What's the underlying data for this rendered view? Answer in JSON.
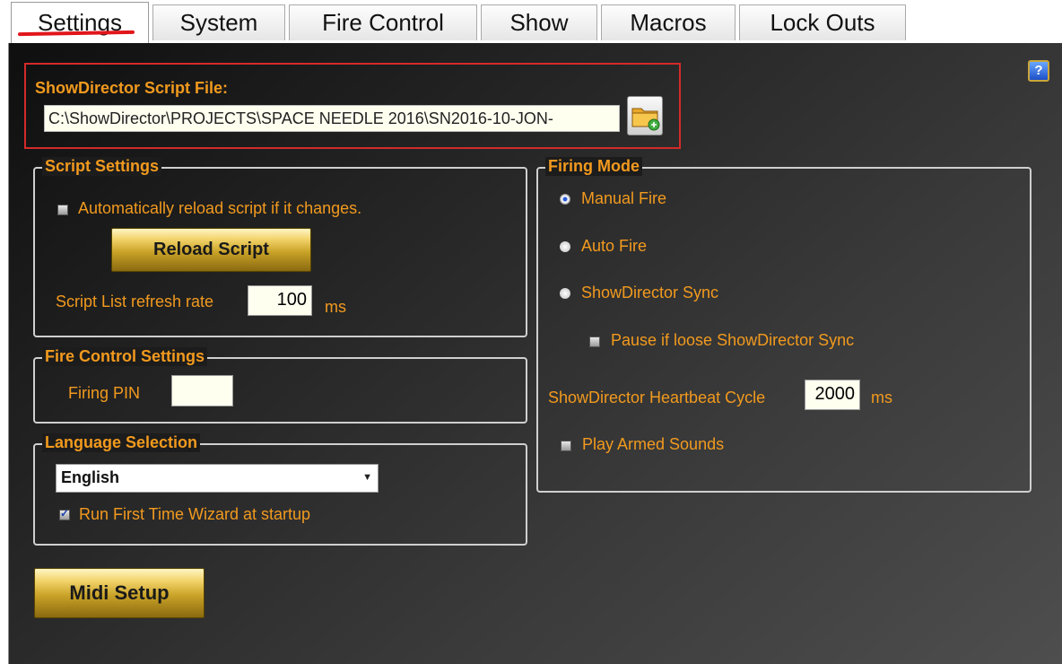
{
  "tabs": [
    {
      "label": "Settings",
      "active": true
    },
    {
      "label": "System"
    },
    {
      "label": "Fire Control"
    },
    {
      "label": "Show"
    },
    {
      "label": "Macros"
    },
    {
      "label": "Lock Outs"
    }
  ],
  "script_file": {
    "label": "ShowDirector Script File:",
    "path": "C:\\ShowDirector\\PROJECTS\\SPACE NEEDLE 2016\\SN2016-10-JON-"
  },
  "script_settings": {
    "title": "Script Settings",
    "auto_reload_label": "Automatically reload script if it changes.",
    "auto_reload_checked": false,
    "reload_button": "Reload Script",
    "refresh_label": "Script List refresh rate",
    "refresh_value": "100",
    "refresh_unit": "ms"
  },
  "fire_control_settings": {
    "title": "Fire Control Settings",
    "pin_label": "Firing PIN",
    "pin_value": ""
  },
  "language": {
    "title": "Language Selection",
    "selected": "English",
    "wizard_label": "Run First Time Wizard at startup",
    "wizard_checked": true
  },
  "midi_button": "Midi Setup",
  "firing_mode": {
    "title": "Firing Mode",
    "options": [
      "Manual Fire",
      "Auto Fire",
      "ShowDirector Sync"
    ],
    "selected": "Manual Fire",
    "pause_label": "Pause if loose ShowDirector Sync",
    "heartbeat_label": "ShowDirector Heartbeat Cycle",
    "heartbeat_value": "2000",
    "heartbeat_unit": "ms",
    "armed_sounds_label": "Play Armed Sounds"
  },
  "icons": {
    "help": "help-icon",
    "folder": "folder-open-icon"
  },
  "colors": {
    "label_orange": "#f29a1e",
    "highlight_red": "#d42a2a",
    "gold_button": "#c9a227"
  }
}
